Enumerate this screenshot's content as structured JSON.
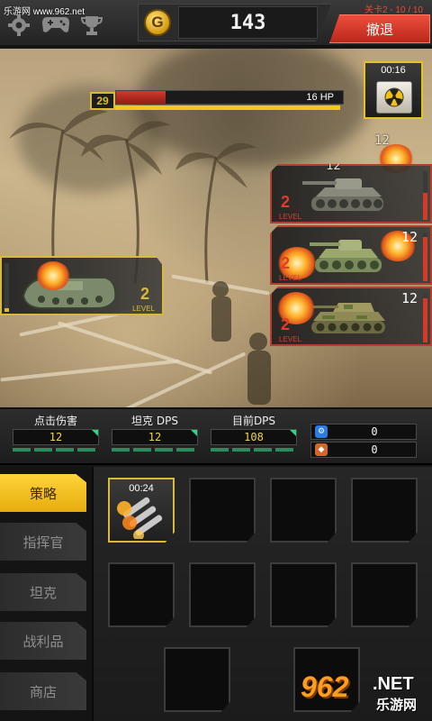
{
  "watermark": {
    "top": "乐游网 www.962.net",
    "logo_big": "962",
    "logo_net": ".NET",
    "logo_cn": "乐游网"
  },
  "header": {
    "gold_icon": "G",
    "gold": "143",
    "stage": "关卡2 - 10 / 10",
    "retreat_label": "撤退",
    "icons": [
      "gear-icon",
      "gamepad-icon",
      "trophy-icon"
    ]
  },
  "battle": {
    "boss_level": "29",
    "boss_hp_text": "16 HP",
    "boss_hp_fraction": 0.22,
    "supply_timer": "00:16",
    "floating_numbers": [
      "12",
      "12",
      "12",
      "12"
    ],
    "enemies": [
      {
        "level": "2",
        "level_label": "LEVEL",
        "hp": "",
        "hp_fraction": 0.55
      },
      {
        "level": "2",
        "level_label": "LEVEL",
        "hp": "12",
        "hp_fraction": 0.9
      },
      {
        "level": "2",
        "level_label": "LEVEL",
        "hp": "12",
        "hp_fraction": 0.9
      }
    ],
    "player": {
      "level": "2",
      "level_label": "LEVEL",
      "hp_fraction": 0.08
    }
  },
  "stats": {
    "tap_damage_label": "点击伤害",
    "tap_damage": "12",
    "tank_dps_label": "坦克 DPS",
    "tank_dps": "12",
    "current_dps_label": "目前DPS",
    "current_dps": "108",
    "resource1": "0",
    "resource2": "0",
    "colors": {
      "accent": "#f2d44a",
      "green": "#2fd48a",
      "gold": "#ffd43a",
      "red": "#e03b2b"
    }
  },
  "sidebar": {
    "items": [
      {
        "label": "策略"
      },
      {
        "label": "指挥官"
      },
      {
        "label": "坦克"
      },
      {
        "label": "战利品"
      },
      {
        "label": "商店"
      }
    ],
    "active_index": 0
  },
  "slots": {
    "first_timer": "00:24"
  }
}
